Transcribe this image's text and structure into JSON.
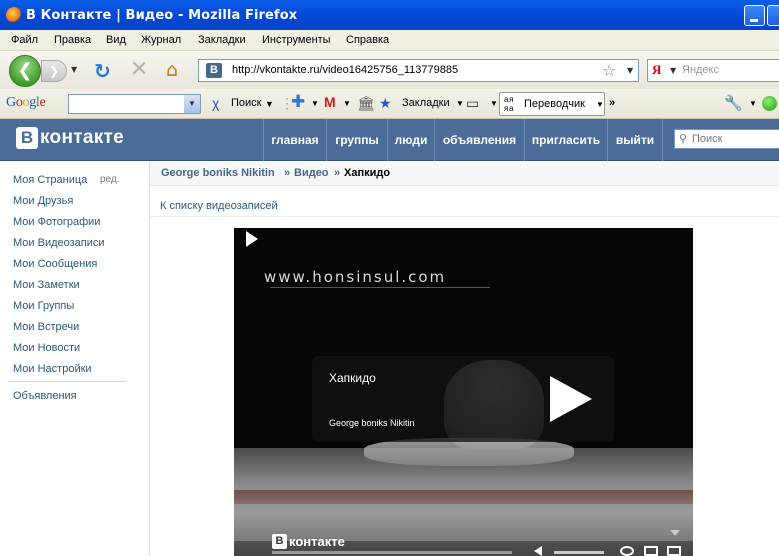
{
  "window": {
    "title": "В Контакте | Видео - Mozilla Firefox"
  },
  "menu": [
    "Файл",
    "Правка",
    "Вид",
    "Журнал",
    "Закладки",
    "Инструменты",
    "Справка"
  ],
  "nav": {
    "url": "http://vkontakte.ru/video16425756_113779885",
    "favicon_label": "В",
    "search_engine_label": "Я",
    "search_placeholder": "Яндекс"
  },
  "google_toolbar": {
    "search_button": "Поиск",
    "bookmarks": "Закладки",
    "translator": "Переводчик",
    "more": "»"
  },
  "vk": {
    "logo_letter": "В",
    "logo_text": "контакте",
    "nav": [
      "главная",
      "группы",
      "люди",
      "объявления",
      "пригласить",
      "выйти"
    ],
    "search_placeholder": "Поиск"
  },
  "sidebar": {
    "edit": "ред.",
    "items": [
      "Моя Страница",
      "Мои Друзья",
      "Мои Фотографии",
      "Мои Видеозаписи",
      "Мои Сообщения",
      "Мои Заметки",
      "Мои Группы",
      "Мои Встречи",
      "Мои Новости",
      "Мои Настройки"
    ],
    "ads": "Объявления"
  },
  "breadcrumb": {
    "user": "George boniks Nikitin",
    "sep": "»",
    "section": "Видео",
    "current": "Хапкидо"
  },
  "back_to_list": "К списку видеозаписей",
  "video": {
    "watermark_site": "www.honsinsul.com",
    "title": "Хапкидо",
    "author": "George boniks Nikitin",
    "player_logo_letter": "В",
    "player_logo_text": "контакте"
  }
}
